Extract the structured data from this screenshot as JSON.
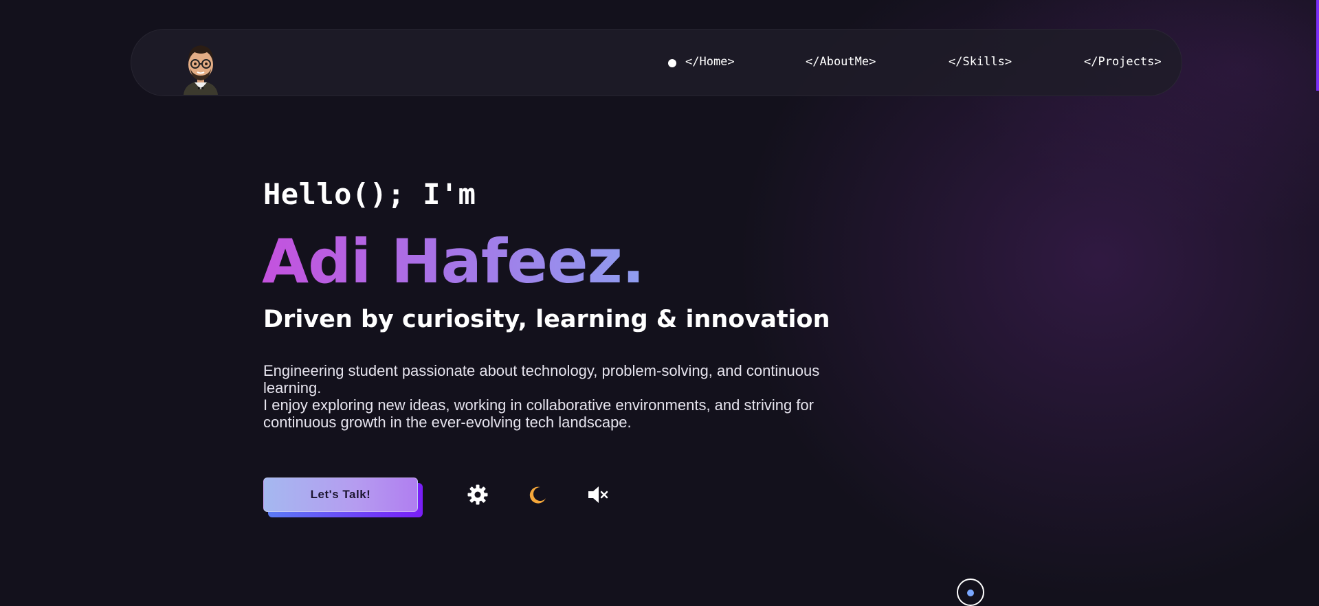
{
  "nav": {
    "avatar_icon": "bitmoji-avatar-icon",
    "links": [
      {
        "label": "</Home>",
        "active": true
      },
      {
        "label": "</AboutMe>",
        "active": false
      },
      {
        "label": "</Skills>",
        "active": false
      },
      {
        "label": "</Projects>",
        "active": false
      }
    ]
  },
  "hero": {
    "greeting": "Hello(); I'm",
    "name": "Adi Hafeez.",
    "tagline": "Driven by curiosity, learning & innovation",
    "description": [
      "Engineering student passionate about technology, problem-solving, and continuous learning.",
      "I enjoy exploring new ideas, working in collaborative environments, and striving for continuous growth in the ever-evolving tech landscape."
    ],
    "cta_label": "Let's Talk!"
  },
  "controls": {
    "settings_icon": "gear-icon",
    "theme_icon": "moon-icon",
    "sound_icon": "speaker-muted-icon"
  },
  "colors": {
    "background": "#13111c",
    "name_gradient_start": "#c452de",
    "name_gradient_end": "#8f9ef0",
    "accent": "#7b2ff7",
    "moon": "#f4a73a"
  }
}
